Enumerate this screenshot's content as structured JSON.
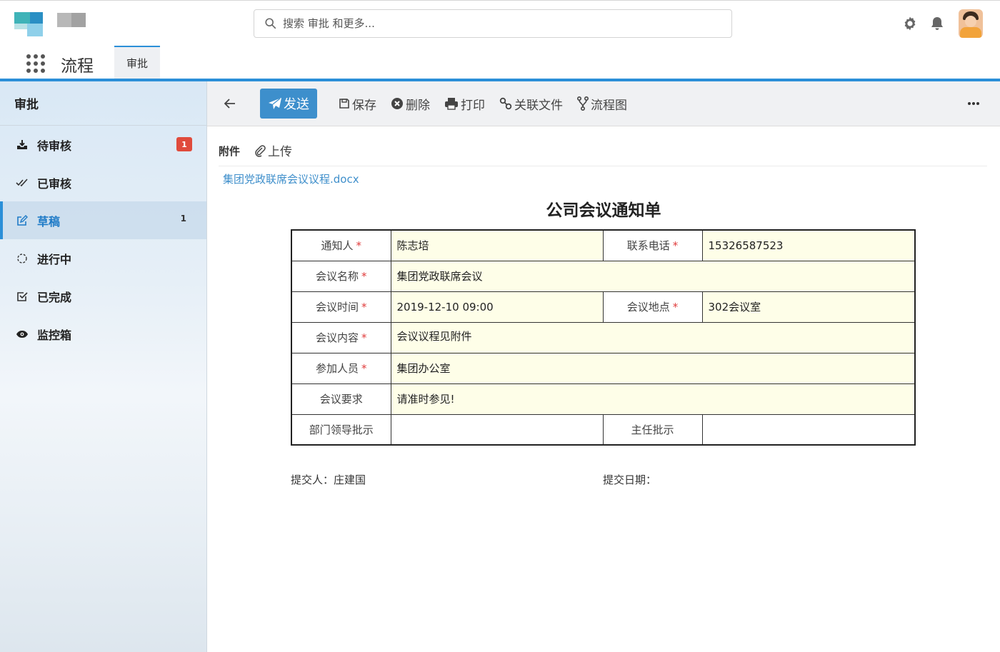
{
  "search": {
    "placeholder": "搜索 审批 和更多..."
  },
  "app": {
    "name": "流程",
    "tab": "审批"
  },
  "sidebar": {
    "title": "审批",
    "items": [
      {
        "label": "待审核",
        "icon": "inbox-download-icon",
        "badge": "1"
      },
      {
        "label": "已审核",
        "icon": "double-check-icon"
      },
      {
        "label": "草稿",
        "icon": "edit-icon",
        "count": "1"
      },
      {
        "label": "进行中",
        "icon": "loading-icon"
      },
      {
        "label": "已完成",
        "icon": "check-square-icon"
      },
      {
        "label": "监控箱",
        "icon": "eye-icon"
      }
    ]
  },
  "toolbar": {
    "send": "发送",
    "save": "保存",
    "delete": "删除",
    "print": "打印",
    "linked_file": "关联文件",
    "flowchart": "流程图"
  },
  "attachments": {
    "label": "附件",
    "upload": "上传",
    "file": "集团党政联席会议议程.docx"
  },
  "form": {
    "title": "公司会议通知单",
    "notifier_label": "通知人",
    "notifier": "陈志培",
    "phone_label": "联系电话",
    "phone": "15326587523",
    "meeting_name_label": "会议名称",
    "meeting_name": "集团党政联席会议",
    "time_label": "会议时间",
    "time": "2019-12-10 09:00",
    "place_label": "会议地点",
    "place": "302会议室",
    "content_label": "会议内容",
    "content": "会议议程见附件",
    "participants_label": "参加人员",
    "participants": "集团办公室",
    "requirement_label": "会议要求",
    "requirement": "请准时参见!",
    "dept_leader_label": "部门领导批示",
    "director_label": "主任批示",
    "required_mark": "*",
    "submitter": "提交人：庄建国",
    "submit_date": "提交日期："
  },
  "colors": {
    "accent": "#2b8fd8",
    "send_button": "#3d8fcc",
    "badge": "#e04b3c",
    "field_bg": "#fefee8",
    "link": "#3f8fcb"
  }
}
